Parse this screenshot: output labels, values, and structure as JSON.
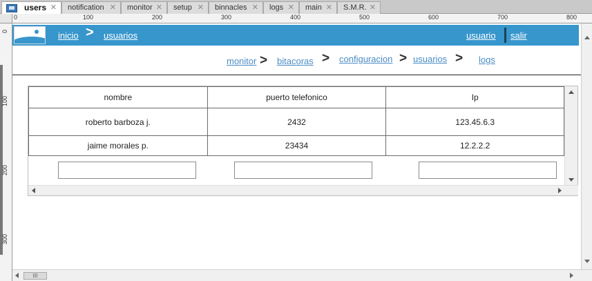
{
  "tabs": [
    {
      "label": "users",
      "active": true
    },
    {
      "label": "notification"
    },
    {
      "label": "monitor"
    },
    {
      "label": "setup"
    },
    {
      "label": "binnacles"
    },
    {
      "label": "logs"
    },
    {
      "label": "main"
    },
    {
      "label": "S.M.R."
    }
  ],
  "ruler": {
    "h": [
      "0",
      "100",
      "200",
      "300",
      "400",
      "500",
      "600",
      "700",
      "800"
    ],
    "v": [
      "0",
      "100",
      "200",
      "300"
    ]
  },
  "header": {
    "inicio": "inicio",
    "sep": ">",
    "usuarios": "usuarios",
    "usuario": "usuario",
    "salir": "salir"
  },
  "nav": {
    "monitor": "monitor",
    "bitacoras": "bitacoras",
    "configuracion": "configuracion",
    "usuarios": "usuarios",
    "logs": "logs",
    "sep": ">"
  },
  "table": {
    "columns": [
      "nombre",
      "puerto telefonico",
      "Ip"
    ],
    "rows": [
      [
        "roberto barboza j.",
        "2432",
        "123.45.6.3"
      ],
      [
        "jaime morales p.",
        "23434",
        "12.2.2.2"
      ]
    ]
  },
  "scroll_thumb": "III",
  "colors": {
    "header_bg": "#3796cc",
    "link": "#4a8cc4"
  }
}
